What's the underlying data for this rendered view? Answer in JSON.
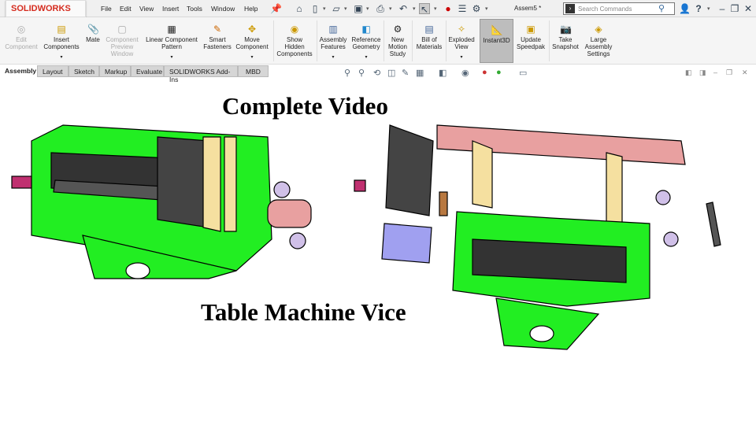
{
  "app": {
    "logo": "SOLIDWORKS",
    "title": "Assem5 *"
  },
  "menu": [
    "File",
    "Edit",
    "View",
    "Insert",
    "Tools",
    "Window",
    "Help"
  ],
  "search": {
    "placeholder": "Search Commands"
  },
  "ribbon": [
    {
      "label": "Edit Component",
      "icon": "edit-component-icon",
      "disabled": true
    },
    {
      "label": "Insert Components",
      "icon": "insert-components-icon"
    },
    {
      "label": "Mate",
      "icon": "paperclip-icon"
    },
    {
      "label": "Component Preview Window",
      "icon": "preview-window-icon",
      "disabled": true
    },
    {
      "label": "Linear Component Pattern",
      "icon": "pattern-icon"
    },
    {
      "label": "Smart Fasteners",
      "icon": "fasteners-icon"
    },
    {
      "label": "Move Component",
      "icon": "move-icon"
    },
    {
      "label": "Show Hidden Components",
      "icon": "show-hidden-icon"
    },
    {
      "label": "Assembly Features",
      "icon": "assembly-features-icon"
    },
    {
      "label": "Reference Geometry",
      "icon": "reference-geometry-icon"
    },
    {
      "label": "New Motion Study",
      "icon": "motion-study-icon"
    },
    {
      "label": "Bill of Materials",
      "icon": "bom-icon"
    },
    {
      "label": "Exploded View",
      "icon": "exploded-view-icon"
    },
    {
      "label": "Instant3D",
      "icon": "instant3d-icon",
      "active": true
    },
    {
      "label": "Update Speedpak",
      "icon": "speedpak-icon"
    },
    {
      "label": "Take Snapshot",
      "icon": "camera-icon"
    },
    {
      "label": "Large Assembly Settings",
      "icon": "large-assembly-icon"
    }
  ],
  "tabs": [
    "Assembly",
    "Layout",
    "Sketch",
    "Markup",
    "Evaluate",
    "SOLIDWORKS Add-Ins",
    "MBD"
  ],
  "overlay": {
    "top": "Complete Video",
    "bottom": "Table Machine Vice"
  },
  "colors": {
    "body": "#22ee22",
    "brand": "#d52b1e",
    "screw": "#e8a0a0",
    "jaw": "#444444",
    "plate": "#a0a0f0",
    "pad": "#f5e0a0"
  }
}
